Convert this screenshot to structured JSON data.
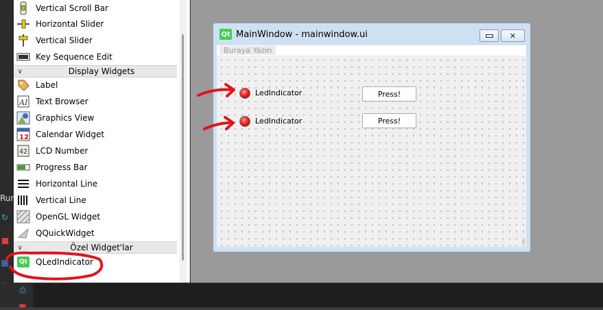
{
  "widget_box": {
    "items_top": [
      {
        "label": "Vertical Scroll Bar",
        "icon": "vertical-scrollbar-icon"
      },
      {
        "label": "Horizontal Slider",
        "icon": "horizontal-slider-icon"
      },
      {
        "label": "Vertical Slider",
        "icon": "vertical-slider-icon"
      },
      {
        "label": "Key Sequence Edit",
        "icon": "key-sequence-icon"
      }
    ],
    "display_category": "Display Widgets",
    "display_items": [
      {
        "label": "Label",
        "icon": "label-tag-icon"
      },
      {
        "label": "Text Browser",
        "icon": "text-browser-icon"
      },
      {
        "label": "Graphics View",
        "icon": "graphics-view-icon"
      },
      {
        "label": "Calendar Widget",
        "icon": "calendar-icon"
      },
      {
        "label": "LCD Number",
        "icon": "lcd-number-icon"
      },
      {
        "label": "Progress Bar",
        "icon": "progress-bar-icon"
      },
      {
        "label": "Horizontal Line",
        "icon": "horizontal-line-icon"
      },
      {
        "label": "Vertical Line",
        "icon": "vertical-line-icon"
      },
      {
        "label": "OpenGL Widget",
        "icon": "opengl-icon"
      },
      {
        "label": "QQuickWidget",
        "icon": "quick-widget-icon"
      }
    ],
    "custom_category": "Özel Widget'lar",
    "custom_items": [
      {
        "label": "QLedIndicator",
        "icon": "qt-icon"
      }
    ],
    "calendar_day": "12",
    "lcd_digits": "42",
    "text_browser_glyph": "AI",
    "custom_icon_text": "Qt"
  },
  "ide": {
    "run_label": "Run"
  },
  "designer_window": {
    "logo_text": "Qt",
    "title": "MainWindow - mainwindow.ui",
    "menu_placeholder": "Buraya Yazın",
    "rows": [
      {
        "led_label": "LedIndicator",
        "button_label": "Press!"
      },
      {
        "led_label": "LedIndicator",
        "button_label": "Press!"
      }
    ],
    "led_color": "#f22020"
  },
  "annotation_color": "#e0141b"
}
